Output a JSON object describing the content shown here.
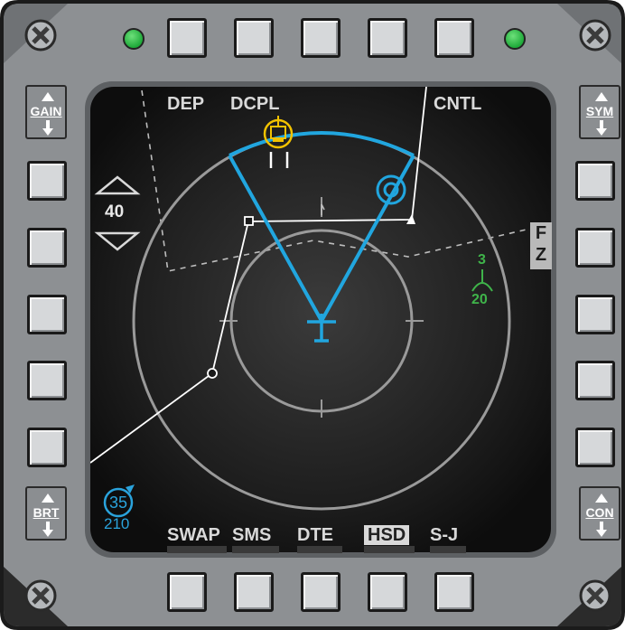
{
  "osb_labels": {
    "top_left_1": "DEP",
    "top_left_2": "DCPL",
    "top_right": "CNTL",
    "bottom_1": "SWAP",
    "bottom_2": "SMS",
    "bottom_3": "DTE",
    "bottom_4": "HSD",
    "bottom_5": "S-J",
    "fz_line1": "F",
    "fz_line2": "Z"
  },
  "rockers": {
    "gain": "GAIN",
    "sym": "SYM",
    "brt": "BRT",
    "con": "CON"
  },
  "range": {
    "value": "40"
  },
  "contact_green": {
    "top": "3",
    "bottom": "20"
  },
  "bullseye": {
    "bearing": "35",
    "range": "210"
  },
  "colors": {
    "bezel": "#8d9093",
    "screen": "#1a1a1a",
    "sensor_cone": "#21a6df",
    "friendly": "#3fb44a",
    "threat": "#f2c200",
    "symbology": "#e6e6e6"
  }
}
